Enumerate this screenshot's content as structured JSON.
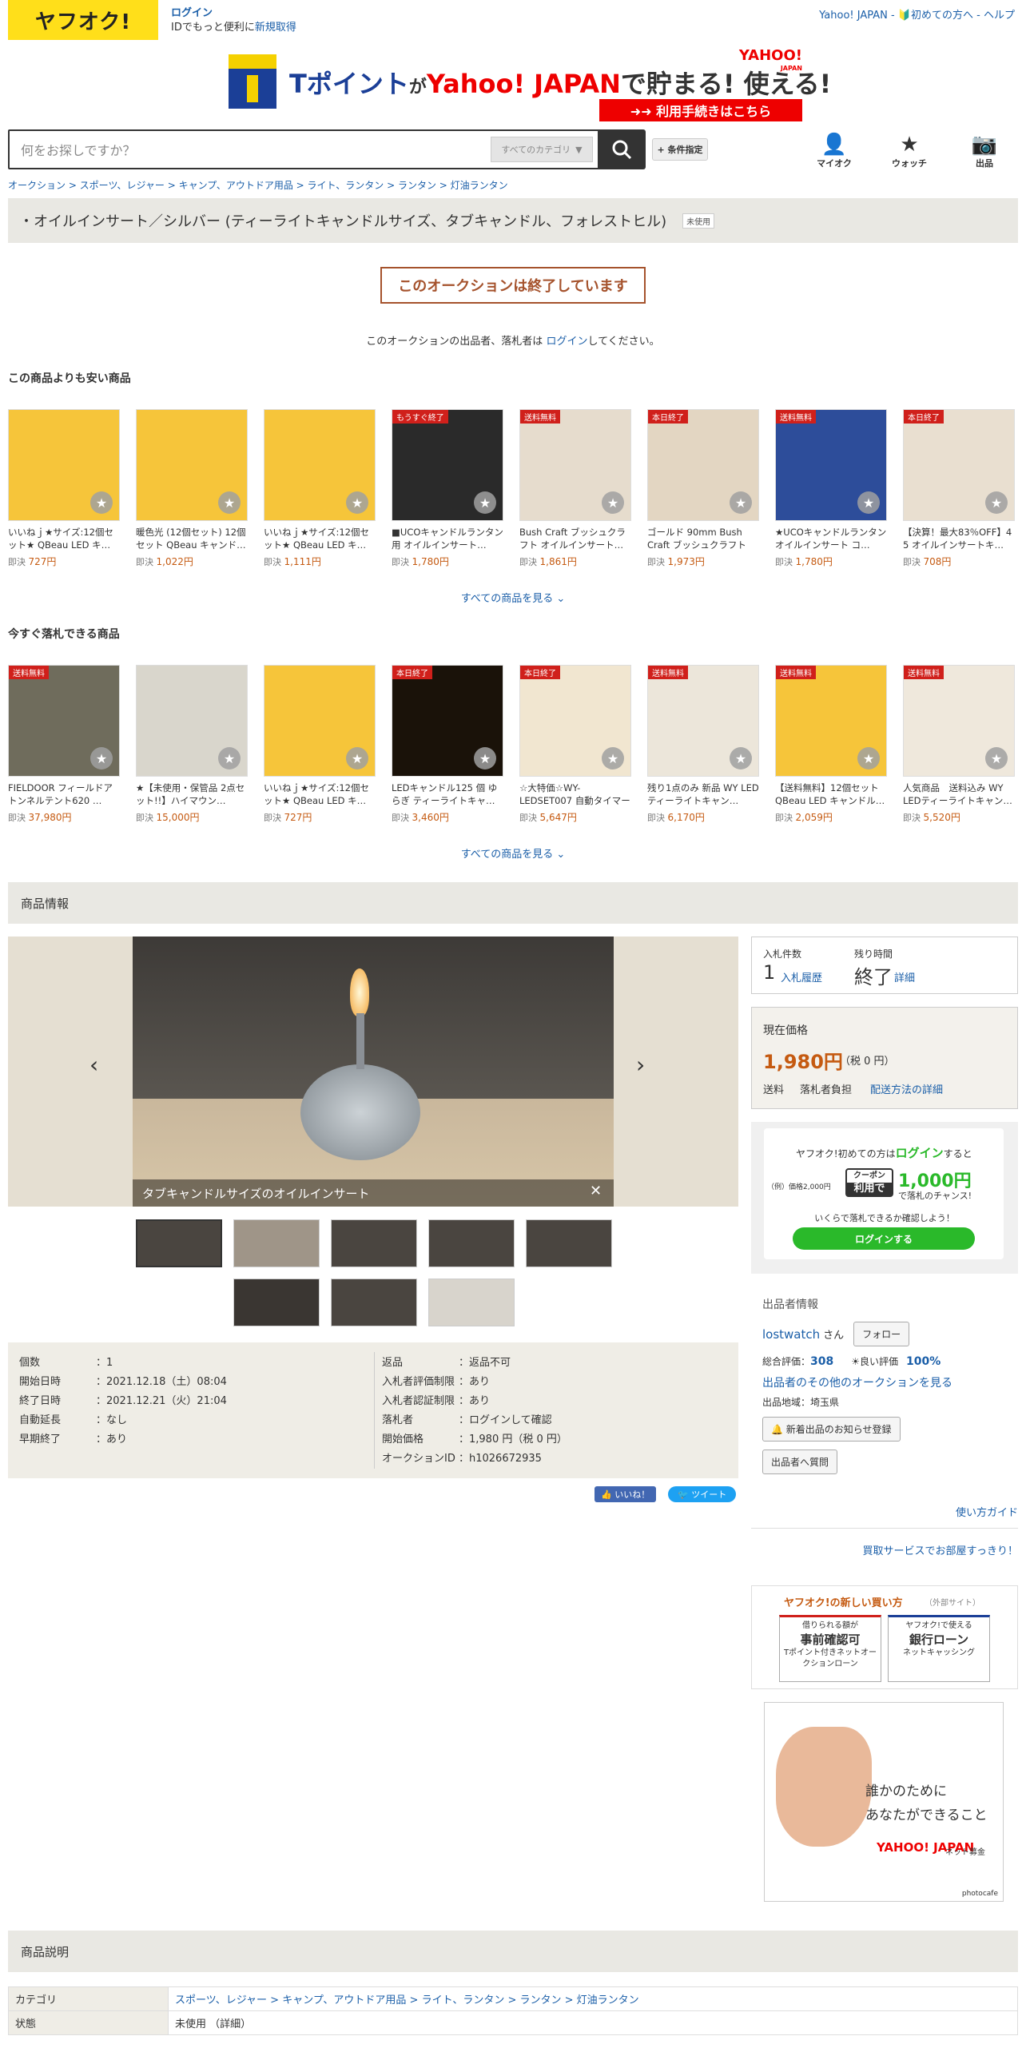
{
  "header": {
    "logo": "ヤフオク!",
    "login": "ログイン",
    "login_sub_prefix": "IDでもっと便利に",
    "register": "新規取得",
    "topright": "Yahoo! JAPAN - 🔰初めての方へ - ヘルプ"
  },
  "banner": {
    "t": "Tポイント",
    "ga": "が",
    "yj": "Yahoo! JAPAN",
    "de": "で貯まる! 使える!",
    "yahoo": "YAHOO!",
    "japan": "JAPAN",
    "cta": "➜➜ 利用手続きはこちら"
  },
  "search": {
    "placeholder": "何をお探しですか？",
    "category": "すべてのカテゴリ",
    "condition": "+ 条件指定"
  },
  "toolbar": {
    "my": "マイオク",
    "watch": "ウォッチ",
    "sell": "出品"
  },
  "breadcrumb": "オークション > スポーツ、レジャー > キャンプ、アウトドア用品 > ライト、ランタン > ランタン > 灯油ランタン",
  "item": {
    "title": "・オイルインサート／シルバー (ティーライトキャンドルサイズ、タブキャンドル、フォレストヒル)",
    "condition_tag": "未使用"
  },
  "ended": {
    "label": "このオークションは終了しています",
    "note_prefix": "このオークションの出品者、落札者は ",
    "note_link": "ログイン",
    "note_suffix": "してください。"
  },
  "cheaper": {
    "heading": "この商品よりも安い商品",
    "see_all": "すべての商品を見る ⌄",
    "items": [
      {
        "title": "いいねｊ★サイズ:12個セット★ QBeau LED キ…",
        "prefix": "即決 ",
        "price": "727円",
        "ribbon": ""
      },
      {
        "title": "暖色光 (12個セット) 12個セット QBeau キャンド…",
        "prefix": "即決 ",
        "price": "1,022円",
        "ribbon": ""
      },
      {
        "title": "いいねｊ★サイズ:12個セット★ QBeau LED キ…",
        "prefix": "即決 ",
        "price": "1,111円",
        "ribbon": ""
      },
      {
        "title": "■UCOキャンドルランタン用 オイルインサート…",
        "prefix": "即決 ",
        "price": "1,780円",
        "ribbon": "もうすぐ終了"
      },
      {
        "title": "Bush Craft ブッシュクラフト オイルインサート…",
        "prefix": "即決 ",
        "price": "1,861円",
        "ribbon": "送料無料"
      },
      {
        "title": "ゴールド 90mm Bush Craft ブッシュクラフト オ…",
        "prefix": "即決 ",
        "price": "1,973円",
        "ribbon": "本日終了"
      },
      {
        "title": "★UCOキャンドルランタン オイルインサート コ…",
        "prefix": "即決 ",
        "price": "1,780円",
        "ribbon": "送料無料"
      },
      {
        "title": "【決算！最大83％OFF】4 5 オイルインサートキ…",
        "prefix": "即決 ",
        "price": "708円",
        "ribbon": "本日終了"
      }
    ]
  },
  "ending": {
    "heading": "今すぐ落札できる商品",
    "see_all": "すべての商品を見る ⌄",
    "items": [
      {
        "title": "FIELDOOR フィールドア トンネルテント620 …",
        "prefix": "即決 ",
        "price": "37,980円",
        "ribbon": "送料無料"
      },
      {
        "title": "★【未使用・保管品 2点セット!!】ハイマウン…",
        "prefix": "即決 ",
        "price": "15,000円",
        "ribbon": ""
      },
      {
        "title": "いいねｊ★サイズ:12個セット★ QBeau LED キ…",
        "prefix": "即決 ",
        "price": "727円",
        "ribbon": ""
      },
      {
        "title": "LEDキャンドル125 個 ゆらぎ ティーライトキャ…",
        "prefix": "即決 ",
        "price": "3,460円",
        "ribbon": "本日終了"
      },
      {
        "title": "☆大特価☆WY-LEDSET007 自動タイマー (ウォ…",
        "prefix": "即決 ",
        "price": "5,647円",
        "ribbon": "本日終了"
      },
      {
        "title": "残り1点のみ 新品 WY LEDティーライトキャン…",
        "prefix": "即決 ",
        "price": "6,170円",
        "ribbon": "送料無料"
      },
      {
        "title": "【送料無料】12個セット QBeau LED キャンドル…",
        "prefix": "即決 ",
        "price": "2,059円",
        "ribbon": "送料無料"
      },
      {
        "title": "人気商品　送料込み WY LEDティーライトキャン…",
        "prefix": "即決 ",
        "price": "5,520円",
        "ribbon": "送料無料"
      }
    ]
  },
  "product_info": {
    "heading": "商品情報",
    "caption": "タブキャンドルサイズのオイルインサート"
  },
  "specs": {
    "left": [
      [
        "個数",
        "：1"
      ],
      [
        "開始日時",
        "：2021.12.18（土）08:04"
      ],
      [
        "終了日時",
        "：2021.12.21（火）21:04"
      ],
      [
        "自動延長",
        "：なし"
      ],
      [
        "早期終了",
        "：あり"
      ]
    ],
    "right": [
      [
        "返品",
        "：返品不可"
      ],
      [
        "入札者評価制限",
        "：あり"
      ],
      [
        "入札者認証制限",
        "：あり"
      ],
      [
        "落札者",
        "：ログインして確認"
      ],
      [
        "開始価格",
        "：1,980 円（税 0 円）"
      ],
      [
        "オークションID",
        "：h1026672935"
      ]
    ]
  },
  "social": {
    "like": "👍 いいね！",
    "tweet": "🐦 ツイート"
  },
  "bid": {
    "count_label": "入札件数",
    "count": "1",
    "history": "入札履歴",
    "remain_label": "残り時間",
    "remain": "終了",
    "detail": "詳細"
  },
  "price": {
    "label": "現在価格",
    "value": "1,980円",
    "tax": "（税 0 円）",
    "ship_label": "送料",
    "ship": "落札者負担",
    "ship_link": "配送方法の詳細"
  },
  "promo": {
    "l1a": "ヤフオク!初めての方は",
    "l1b": "ログイン",
    "l1c": "すると",
    "ex": "（例）価格2,000円",
    "coupon": "クーポン",
    "use": "利用で",
    "amount": "1,000円",
    "chance": "で落札のチャンス!",
    "l3": "いくらで落札できるか確認しよう！",
    "btn": "ログインする"
  },
  "seller": {
    "heading": "出品者情報",
    "name": "lostwatch",
    "san": "さん",
    "follow": "フォロー",
    "rate_label": "総合評価：",
    "rate": "308",
    "good_label": "☀良い評価",
    "good": "100%",
    "other": "出品者のその他のオークションを見る",
    "region": "出品地域：埼玉県",
    "notify": "🔔 新着出品のお知らせ登録",
    "question": "出品者へ質問"
  },
  "guides": {
    "howto": "使い方ガイド",
    "club": "買取サービスでお部屋すっきり！"
  },
  "newbuy": {
    "title": "ヤフオク!の新しい買い方",
    "sub": "（外部サイト）",
    "b1s": "借りられる額が",
    "b1": "事前確認可",
    "b1x": "Tポイント付きネットオークションローン",
    "b2s": "ヤフオク!で使える",
    "b2": "銀行ローン",
    "b2x": "ネットキャッシング"
  },
  "ad": {
    "line1": "誰かのために",
    "line2": "あなたができること",
    "brand": "YAHOO! JAPAN",
    "bank": "ネット募金",
    "credit": "photocafe"
  },
  "desc": {
    "heading": "商品説明",
    "rows": [
      [
        "カテゴリ",
        "スポーツ、レジャー > キャンプ、アウトドア用品 > ライト、ランタン > ランタン > 灯油ランタン"
      ],
      [
        "状態",
        "未使用 （詳細）"
      ]
    ]
  },
  "colors": {
    "accent": "#ffdf1a",
    "price": "#c55a11",
    "link": "#1a5ea8",
    "ended": "#a5522c",
    "green": "#2ab92a"
  }
}
